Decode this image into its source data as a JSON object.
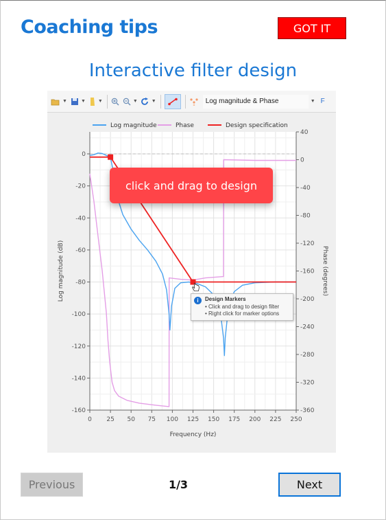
{
  "header": {
    "title": "Coaching tips",
    "got_it_label": "GOT IT",
    "subtitle": "Interactive filter design"
  },
  "toolbar": {
    "icons": [
      "open-folder-icon",
      "save-icon",
      "folder-icon",
      "zoom-in-icon",
      "zoom-out-icon",
      "redo-icon",
      "design-markers-icon",
      "marker-points-icon"
    ],
    "view_select_value": "Log magnitude & Phase"
  },
  "callout": {
    "text": "click and drag to design"
  },
  "design_markers_tooltip": {
    "title": "Design Markers",
    "line1": "• Click and drag to design filter",
    "line2": "• Right click for marker options"
  },
  "colors": {
    "accent": "#1a78d4",
    "got_it": "#ff0000",
    "log_magnitude": "#4aa3f0",
    "phase": "#e49ee6",
    "design_spec": "#ee2222",
    "callout": "#ff4448"
  },
  "chart_data": {
    "type": "line",
    "title": "",
    "xlabel": "Frequency (Hz)",
    "ylabel": "Log magnitude (dB)",
    "y2label": "Phase (degrees)",
    "xlim": [
      0,
      250
    ],
    "ylim": [
      -160,
      10
    ],
    "y2lim": [
      -360,
      40
    ],
    "x_ticks": [
      "0",
      "25",
      "50",
      "75",
      "100",
      "125",
      "150",
      "175",
      "200",
      "225",
      "250"
    ],
    "y_ticks": [
      "0",
      "-20",
      "-40",
      "-60",
      "-80",
      "-100",
      "-120",
      "-140",
      "-160"
    ],
    "y2_ticks": [
      "40",
      "0",
      "-40",
      "-80",
      "-120",
      "-160",
      "-200",
      "-240",
      "-280",
      "-320",
      "-360"
    ],
    "grid": true,
    "legend_position": "top",
    "legend": [
      "Log magnitude",
      "Phase",
      "Design specification"
    ],
    "series": [
      {
        "name": "Log magnitude",
        "axis": "left",
        "x": [
          0,
          5,
          10,
          15,
          20,
          25,
          28,
          32,
          40,
          50,
          60,
          70,
          80,
          88,
          93,
          96,
          97,
          99,
          103,
          110,
          120,
          130,
          140,
          150,
          158,
          162,
          163,
          164,
          168,
          175,
          185,
          200,
          225,
          250
        ],
        "y": [
          -1,
          -0.5,
          0.5,
          0.2,
          -1,
          -2,
          -10,
          -25,
          -38,
          -47,
          -54,
          -60,
          -67,
          -75,
          -85,
          -100,
          -110,
          -95,
          -84,
          -80.5,
          -80,
          -81,
          -83,
          -88,
          -98,
          -115,
          -126,
          -115,
          -95,
          -86,
          -82,
          -80.5,
          -80,
          -80
        ]
      },
      {
        "name": "Phase",
        "axis": "right",
        "x": [
          0,
          5,
          10,
          15,
          20,
          22,
          24,
          25,
          27,
          30,
          35,
          45,
          60,
          80,
          96,
          96.1,
          110,
          125,
          140,
          162,
          162.1,
          200,
          250
        ],
        "y": [
          -20,
          -60,
          -110,
          -160,
          -220,
          -260,
          -290,
          -300,
          -320,
          -332,
          -340,
          -346,
          -350,
          -353,
          -355,
          -170,
          -172,
          -173,
          -170,
          -168,
          0,
          -1,
          -1
        ]
      },
      {
        "name": "Design specification",
        "axis": "left",
        "x": [
          0,
          25,
          125,
          250
        ],
        "y": [
          -2,
          -2,
          -80,
          -80
        ],
        "markers": [
          [
            25,
            -2
          ],
          [
            125,
            -80
          ]
        ]
      }
    ],
    "reference_line": {
      "axis": "left",
      "y": 0,
      "style": "dashed"
    }
  },
  "navigation": {
    "previous_label": "Previous",
    "page_indicator": "1/3",
    "next_label": "Next"
  }
}
